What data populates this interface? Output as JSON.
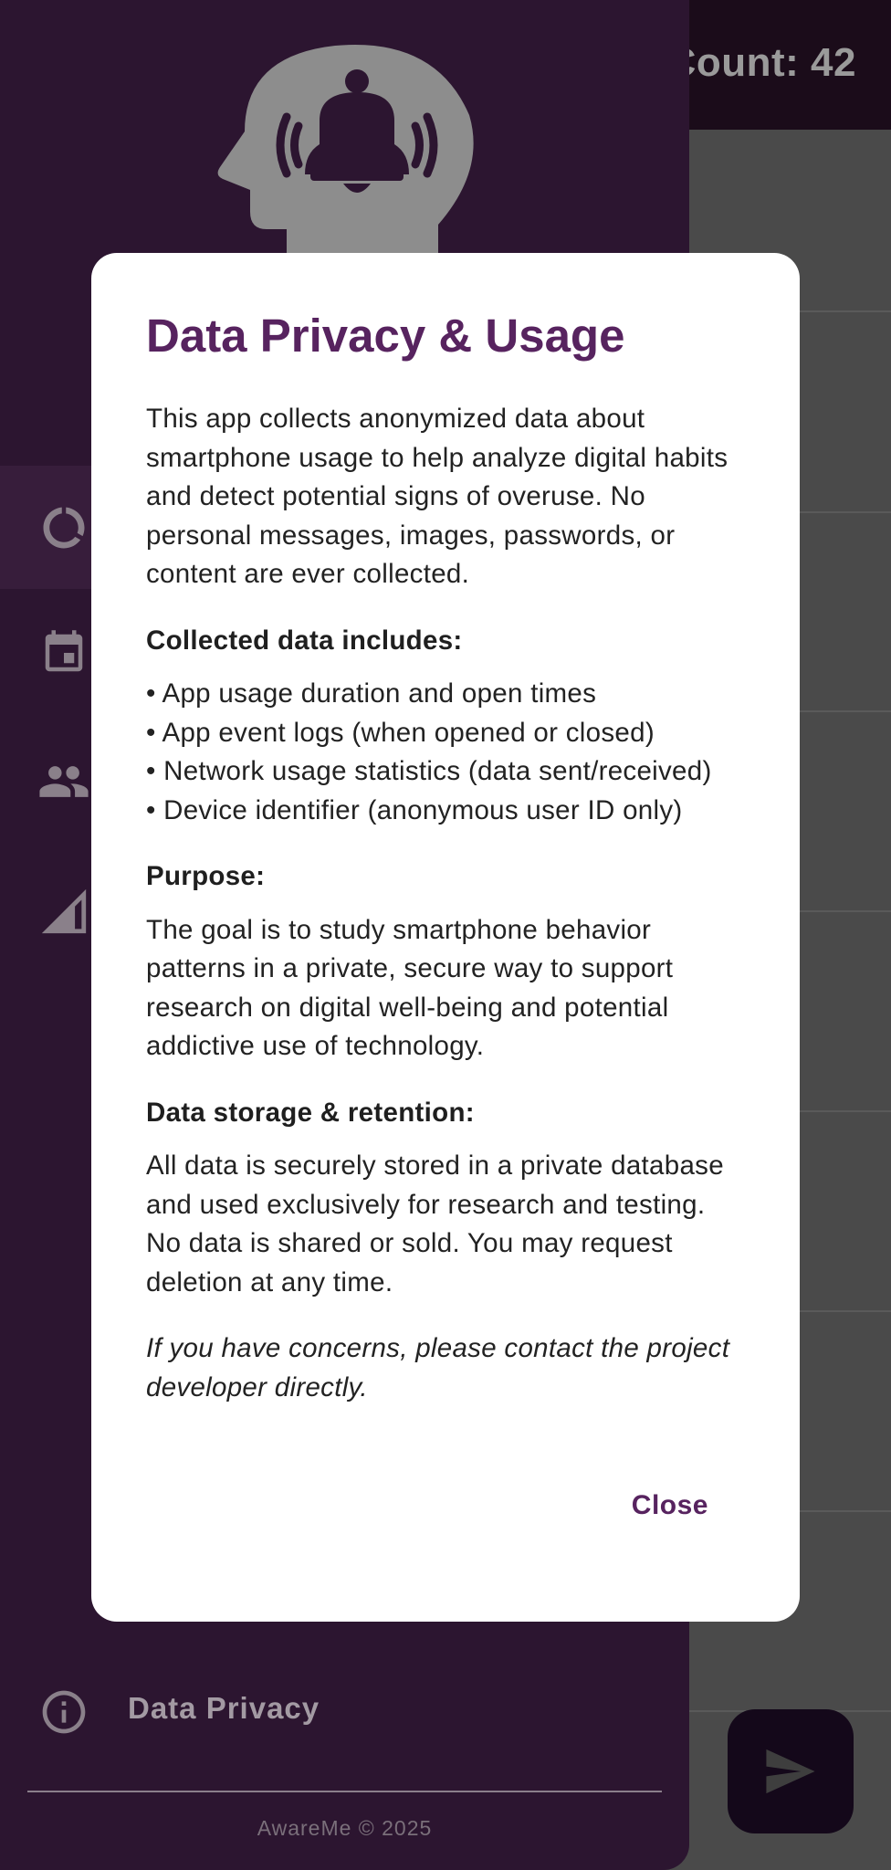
{
  "app_bar": {
    "title": "Count: 42"
  },
  "drawer": {
    "header_icon": "head-bell-icon",
    "nav_icons": [
      "progress-circle-icon",
      "calendar-icon",
      "people-icon",
      "signal-icon"
    ],
    "privacy_item": {
      "icon": "info-icon",
      "label": "Data Privacy"
    },
    "footer": "AwareMe © 2025"
  },
  "fab": {
    "icon": "send-icon"
  },
  "dialog": {
    "title": "Data Privacy & Usage",
    "intro": "This app collects anonymized data about smartphone usage to help analyze digital habits and detect potential signs of overuse. No personal messages, images, passwords, or content are ever collected.",
    "collected_heading": "Collected data includes:",
    "collected_items": [
      "• App usage duration and open times",
      "• App event logs (when opened or closed)",
      "• Network usage statistics (data sent/received)",
      "• Device identifier (anonymous user ID only)"
    ],
    "purpose_heading": "Purpose:",
    "purpose_text": "The goal is to study smartphone behavior patterns in a private, secure way to support research on digital well-being and potential addictive use of technology.",
    "storage_heading": "Data storage & retention:",
    "storage_text": "All data is securely stored in a private database and used exclusively for research and testing. No data is shared or sold. You may request deletion at any time.",
    "contact_note": "If you have concerns, please contact the project developer directly.",
    "close_label": "Close"
  },
  "colors": {
    "drawer_bg": "#2c1530",
    "appbar_bg": "#1b0c1a",
    "accent": "#57235f",
    "scrim_bg": "#4a4a4a"
  }
}
